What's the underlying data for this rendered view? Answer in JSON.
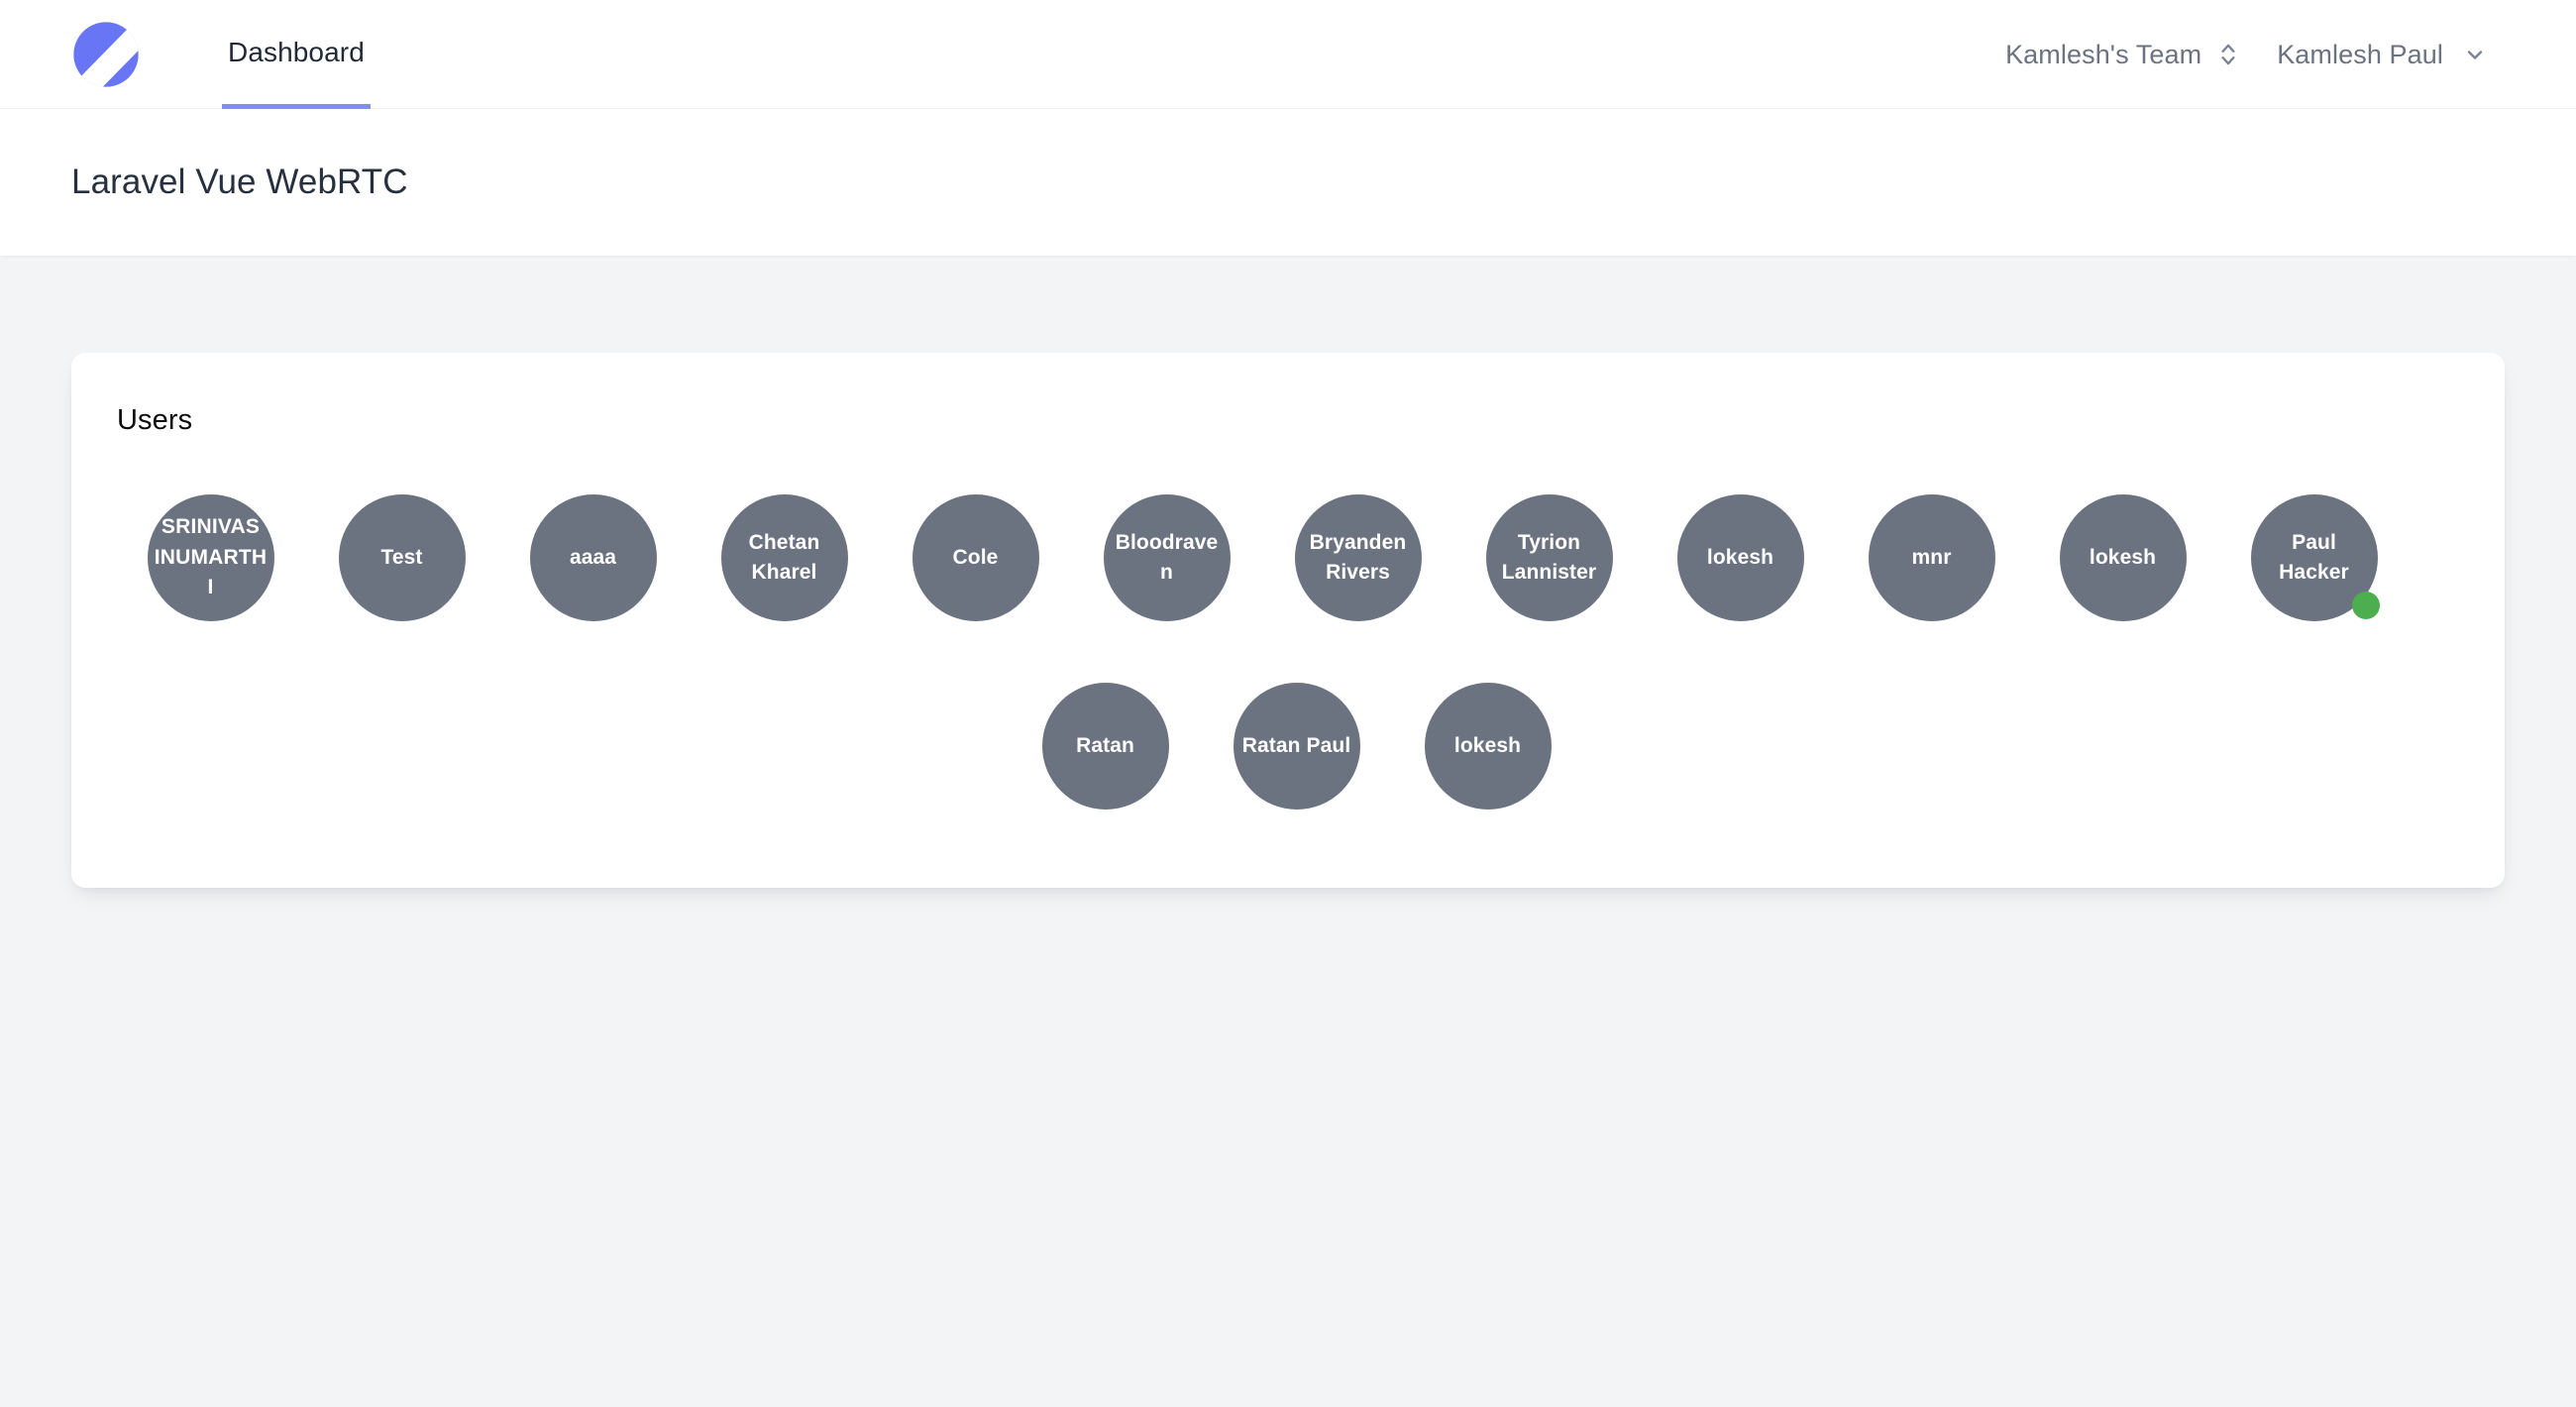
{
  "nav": {
    "logo_icon": "jetstream-logo-icon",
    "logo_color": "#6875F5",
    "links": [
      {
        "label": "Dashboard",
        "active": true
      }
    ],
    "team_switcher": {
      "label": "Kamlesh's Team",
      "icon": "selector-up-down-icon"
    },
    "user_menu": {
      "label": "Kamlesh Paul",
      "icon": "chevron-down-icon"
    },
    "active_underline_color": "#818CF8"
  },
  "header": {
    "title": "Laravel Vue WebRTC"
  },
  "card": {
    "title": "Users",
    "avatar_color": "#6B7280",
    "online_color": "#4CAE4F",
    "rows": [
      {
        "users": [
          {
            "name": "SRINIVAS INUMARTHI",
            "online": false,
            "caps": true
          },
          {
            "name": "Test",
            "online": false,
            "caps": false
          },
          {
            "name": "aaaa",
            "online": false,
            "caps": false
          },
          {
            "name": "Chetan Kharel",
            "online": false,
            "caps": false
          },
          {
            "name": "Cole",
            "online": false,
            "caps": false
          },
          {
            "name": "Bloodraven",
            "online": false,
            "caps": false
          },
          {
            "name": "Bryanden Rivers",
            "online": false,
            "caps": false
          },
          {
            "name": "Tyrion Lannister",
            "online": false,
            "caps": false
          },
          {
            "name": "lokesh",
            "online": false,
            "caps": false
          },
          {
            "name": "mnr",
            "online": false,
            "caps": false
          },
          {
            "name": "lokesh",
            "online": false,
            "caps": false
          },
          {
            "name": "Paul Hacker",
            "online": true,
            "caps": false
          }
        ]
      },
      {
        "users": [
          {
            "name": "Ratan",
            "online": false,
            "caps": false
          },
          {
            "name": "Ratan Paul",
            "online": false,
            "caps": false
          },
          {
            "name": "lokesh",
            "online": false,
            "caps": false
          }
        ]
      }
    ]
  }
}
